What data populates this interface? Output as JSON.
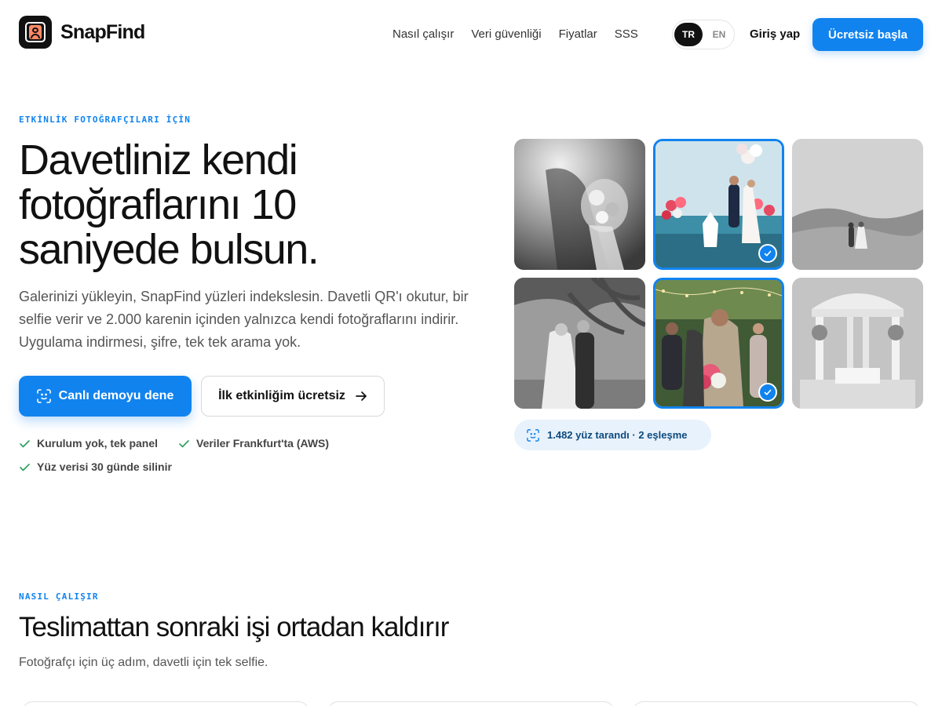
{
  "brand": {
    "name": "SnapFind",
    "icon": "face-frame-logo"
  },
  "nav": {
    "links": [
      "Nasıl çalışır",
      "Veri güvenliği",
      "Fiyatlar",
      "SSS"
    ],
    "lang_active": "TR",
    "lang_other": "EN",
    "login": "Giriş yap",
    "cta": "Ücretsiz başla"
  },
  "hero": {
    "eyebrow": "ETKİNLİK FOTOĞRAFÇILARI İÇİN",
    "title_lines": [
      "Davetliniz kendi",
      "fotoğraflarını 10",
      "saniyede bulsun."
    ],
    "subtitle": "Galerinizi yükleyin, SnapFind yüzleri indekslesin. Davetli QR'ı okutur, bir selfie verir ve 2.000 karenin içinden yalnızca kendi fotoğraflarını indirir. Uygulama indirmesi, şifre, tek tek arama yok.",
    "primary_cta": "Canlı demoyu dene",
    "secondary_cta": "İlk etkinliğim ücretsiz",
    "checks": [
      "Kurulum yok, tek panel",
      "Veriler Frankfurt'ta (AWS)",
      "Yüz verisi 30 günde silinir"
    ]
  },
  "gallery": {
    "tiles": [
      {
        "name": "bouquet-photo",
        "matched": false
      },
      {
        "name": "balloons-ceremony-photo",
        "matched": true
      },
      {
        "name": "couple-hills-photo",
        "matched": false
      },
      {
        "name": "couple-palm-photo",
        "matched": false
      },
      {
        "name": "guests-kiss-photo",
        "matched": true
      },
      {
        "name": "gazebo-photo",
        "matched": false
      }
    ],
    "scan_status": "1.482 yüz tarandı · 2 eşleşme"
  },
  "how_it_works": {
    "eyebrow": "NASIL ÇALIŞIR",
    "title": "Teslimattan sonraki işi ortadan kaldırır",
    "subtitle": "Fotoğrafçı için üç adım, davetli için tek selfie."
  },
  "colors": {
    "accent": "#1183ef",
    "text": "#111111",
    "muted": "#555555",
    "pill_bg": "#e8f2fc"
  }
}
